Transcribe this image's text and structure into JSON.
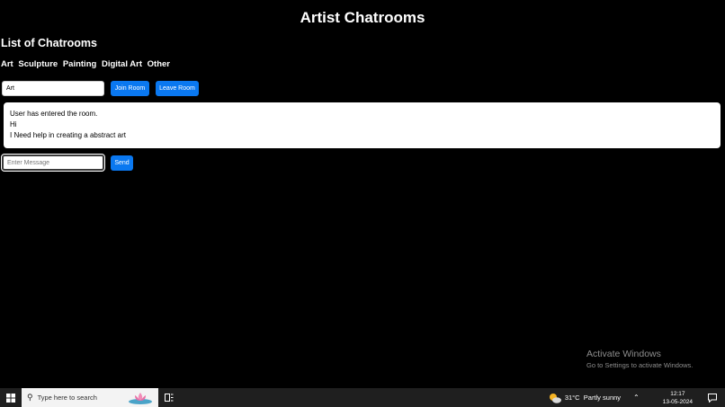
{
  "header": {
    "title": "Artist Chatrooms"
  },
  "rooms_section": {
    "heading": "List of Chatrooms",
    "rooms": [
      "Art",
      "Sculpture",
      "Painting",
      "Digital Art",
      "Other"
    ]
  },
  "room_controls": {
    "room_input_value": "Art",
    "join_label": "Join Room",
    "leave_label": "Leave Room"
  },
  "messages": [
    "User has entered the room.",
    "Hi",
    "I Need help in creating a abstract art"
  ],
  "composer": {
    "placeholder": "Enter Message",
    "send_label": "Send"
  },
  "watermark": {
    "title": "Activate Windows",
    "subtitle": "Go to Settings to activate Windows."
  },
  "taskbar": {
    "search_placeholder": "Type here to search",
    "weather": {
      "temp": "31°C",
      "desc": "Partly sunny"
    },
    "time": "12:17",
    "date": "13-05-2024"
  },
  "colors": {
    "background": "#000000",
    "accent": "#0a78f0",
    "taskbar": "#1f1f1f"
  }
}
